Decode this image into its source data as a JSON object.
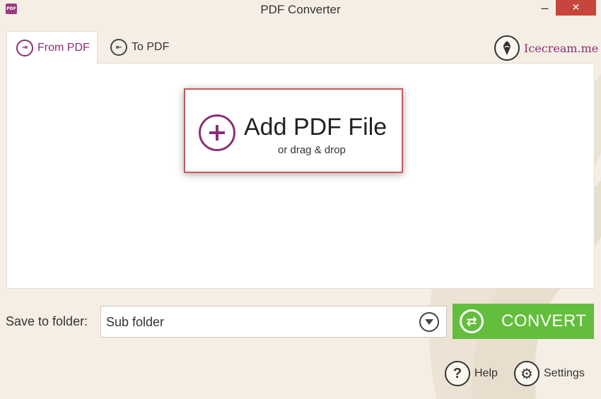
{
  "window": {
    "title": "PDF Converter",
    "app_icon_text": "PDF",
    "minimize_symbol": "–",
    "close_symbol": "✕",
    "close_color": "#c7463b"
  },
  "tabs": [
    {
      "label": "From PDF",
      "icon": "from-pdf-icon",
      "active": true
    },
    {
      "label": "To PDF",
      "icon": "to-pdf-icon",
      "active": false
    }
  ],
  "brand": {
    "label": "Icecream.me",
    "icon": "icecream-logo-icon",
    "color": "#8a2f74"
  },
  "dropzone": {
    "title": "Add PDF File",
    "subtitle": "or drag & drop",
    "icon": "add-plus-icon",
    "border_color": "#c45a5a"
  },
  "save": {
    "label": "Save to folder:",
    "selected": "Sub folder",
    "icon": "dropdown-arrow-icon"
  },
  "convert": {
    "label": "CONVERT",
    "icon": "refresh-icon",
    "color": "#62be3c"
  },
  "footer": {
    "help_label": "Help",
    "help_icon": "question-icon",
    "settings_label": "Settings",
    "settings_icon": "gear-icon"
  }
}
